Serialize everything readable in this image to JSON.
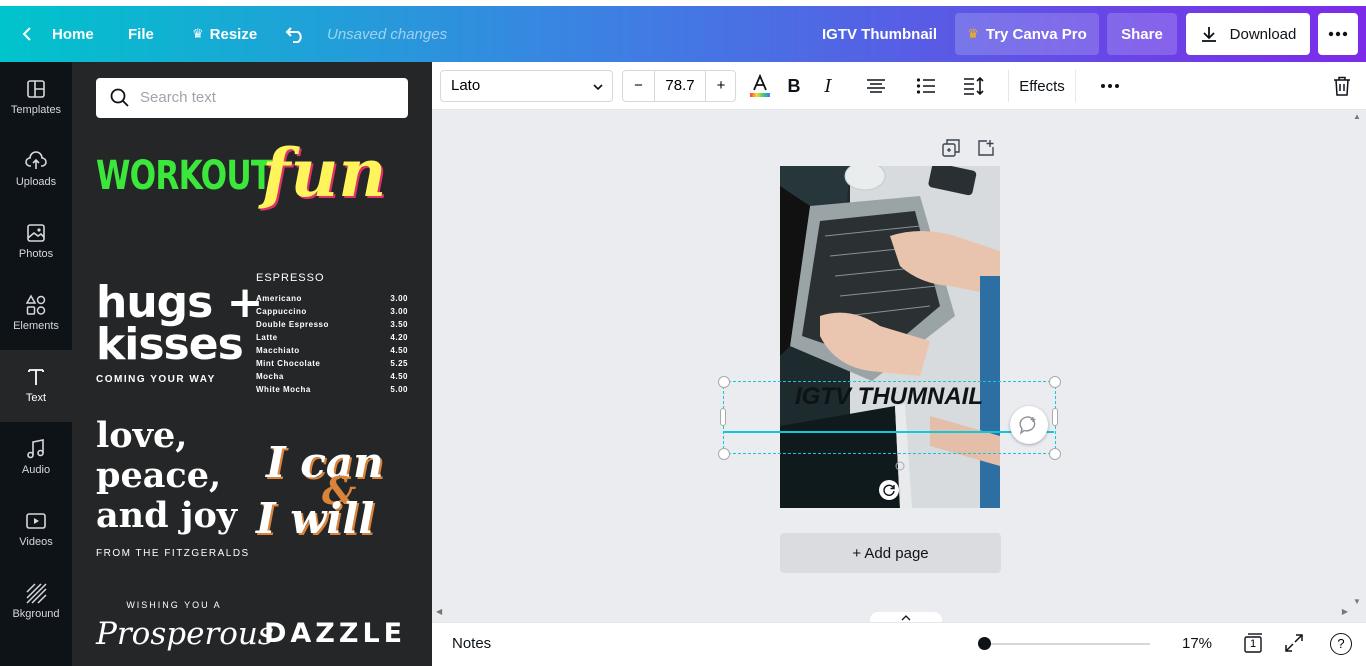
{
  "header": {
    "home_label": "Home",
    "file_label": "File",
    "resize_label": "Resize",
    "status": "Unsaved changes",
    "doc_title": "IGTV Thumbnail",
    "pro_label": "Try Canva Pro",
    "share_label": "Share",
    "download_label": "Download"
  },
  "rail": {
    "items": [
      {
        "label": "Templates",
        "icon": "templates-icon"
      },
      {
        "label": "Uploads",
        "icon": "upload-icon"
      },
      {
        "label": "Photos",
        "icon": "photo-icon"
      },
      {
        "label": "Elements",
        "icon": "elements-icon"
      },
      {
        "label": "Text",
        "icon": "text-icon"
      },
      {
        "label": "Audio",
        "icon": "audio-icon"
      },
      {
        "label": "Videos",
        "icon": "video-icon"
      },
      {
        "label": "Bkground",
        "icon": "background-icon"
      }
    ]
  },
  "panel": {
    "search_placeholder": "Search text",
    "samples": {
      "workout": "WORKOUT",
      "fun": "fun",
      "hugs": "hugs +",
      "kisses": "kisses",
      "coming": "COMING YOUR WAY",
      "espresso": "ESPRESSO",
      "menu": [
        {
          "name": "Americano",
          "price": "3.00"
        },
        {
          "name": "Cappuccino",
          "price": "3.00"
        },
        {
          "name": "Double Espresso",
          "price": "3.50"
        },
        {
          "name": "Latte",
          "price": "4.20"
        },
        {
          "name": "Macchiato",
          "price": "4.50"
        },
        {
          "name": "Mint Chocolate",
          "price": "5.25"
        },
        {
          "name": "Mocha",
          "price": "4.50"
        },
        {
          "name": "White Mocha",
          "price": "5.00"
        }
      ],
      "love1": "love,",
      "love2": "peace,",
      "love3": "and joy",
      "fitz": "FROM THE FITZGERALDS",
      "ican": "I can",
      "amp": "&",
      "iwill": "I will",
      "wishing": "WISHING YOU A",
      "prosperous": "Prosperous",
      "dazzle": "DAZZLE"
    }
  },
  "toolbar": {
    "font": "Lato",
    "size": "78.7",
    "effects": "Effects"
  },
  "canvas": {
    "text": "IGTV THUMNAIL",
    "add_page": "+ Add page"
  },
  "bottom": {
    "notes": "Notes",
    "zoom": "17%",
    "page_num": "1"
  },
  "colors": {
    "accent": "#00c4cc",
    "brand_purple": "#7d2ae8",
    "selection": "#13c7d9"
  }
}
